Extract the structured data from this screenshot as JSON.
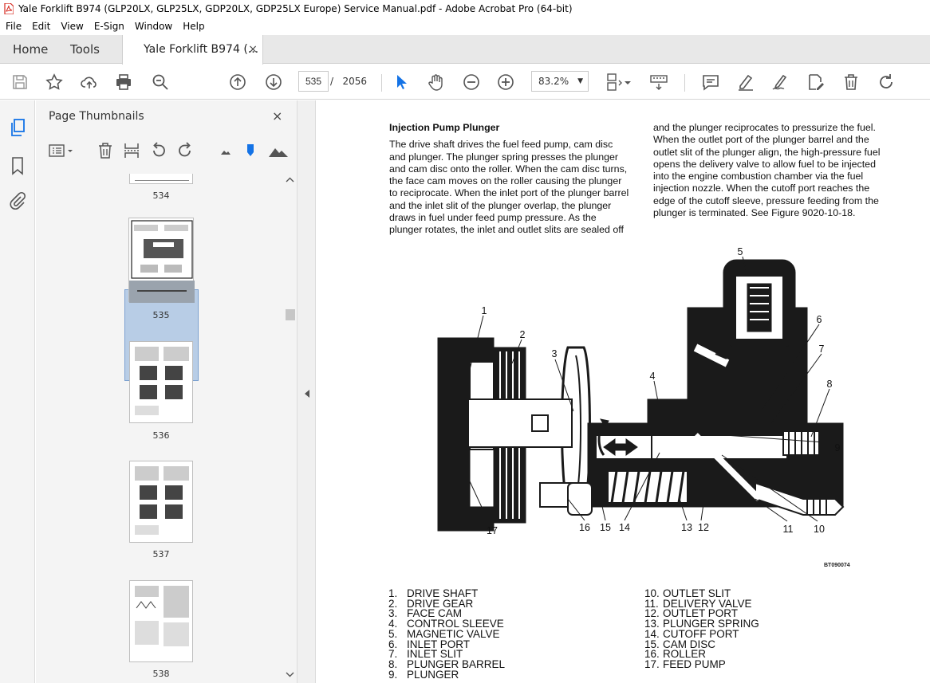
{
  "window": {
    "title": "Yale Forklift B974 (GLP20LX, GLP25LX, GDP20LX, GDP25LX Europe) Service Manual.pdf - Adobe Acrobat Pro (64-bit)"
  },
  "menu": [
    "File",
    "Edit",
    "View",
    "E-Sign",
    "Window",
    "Help"
  ],
  "tabs": {
    "home": "Home",
    "tools": "Tools",
    "doc": "Yale Forklift B974 (...",
    "close": "×"
  },
  "toolbar": {
    "current_page": "535",
    "page_separator": "/",
    "total_pages": "2056",
    "zoom": "83.2%"
  },
  "panel": {
    "title": "Page Thumbnails",
    "close": "×",
    "thumbnails": [
      {
        "label": "534"
      },
      {
        "label": "535"
      },
      {
        "label": "536"
      },
      {
        "label": "537"
      },
      {
        "label": "538"
      }
    ]
  },
  "document": {
    "heading": "Injection Pump Plunger",
    "left_lines": [
      "The drive shaft drives the fuel feed pump, cam disc",
      "and plunger. The plunger spring presses the plunger",
      "and cam disc onto the roller. When the cam disc turns,",
      "the face cam moves on the roller causing the plunger",
      "to reciprocate. When the inlet port of the plunger barrel",
      "and the inlet slit of the plunger overlap, the plunger",
      "draws in fuel under feed pump pressure. As the",
      "plunger rotates, the inlet and outlet slits are sealed off"
    ],
    "right_lines": [
      "and the plunger reciprocates to pressurize the fuel.",
      "When the outlet port of the plunger barrel and the",
      "outlet slit of the plunger align, the high-pressure fuel",
      "opens the delivery valve to allow fuel to be injected",
      "into the engine combustion chamber via the fuel",
      "injection nozzle. When the cutoff port reaches the",
      "edge of the cutoff sleeve, pressure feeding from the",
      "plunger is terminated. See Figure 9020-10-18."
    ],
    "figure_code": "BT090074",
    "callouts": [
      "1",
      "2",
      "3",
      "4",
      "5",
      "6",
      "7",
      "8",
      "9",
      "10",
      "11",
      "12",
      "13",
      "14",
      "15",
      "16",
      "17"
    ],
    "legend_left": [
      {
        "n": "1.",
        "t": "DRIVE SHAFT"
      },
      {
        "n": "2.",
        "t": "DRIVE GEAR"
      },
      {
        "n": "3.",
        "t": "FACE CAM"
      },
      {
        "n": "4.",
        "t": "CONTROL SLEEVE"
      },
      {
        "n": "5.",
        "t": "MAGNETIC VALVE"
      },
      {
        "n": "6.",
        "t": "INLET PORT"
      },
      {
        "n": "7.",
        "t": "INLET SLIT"
      },
      {
        "n": "8.",
        "t": "PLUNGER BARREL"
      },
      {
        "n": "9.",
        "t": "PLUNGER"
      }
    ],
    "legend_right": [
      {
        "n": "10.",
        "t": "OUTLET SLIT"
      },
      {
        "n": "11.",
        "t": "DELIVERY VALVE"
      },
      {
        "n": "12.",
        "t": "OUTLET PORT"
      },
      {
        "n": "13.",
        "t": "PLUNGER SPRING"
      },
      {
        "n": "14.",
        "t": "CUTOFF PORT"
      },
      {
        "n": "15.",
        "t": "CAM DISC"
      },
      {
        "n": "16.",
        "t": "ROLLER"
      },
      {
        "n": "17.",
        "t": "FEED PUMP"
      }
    ]
  }
}
